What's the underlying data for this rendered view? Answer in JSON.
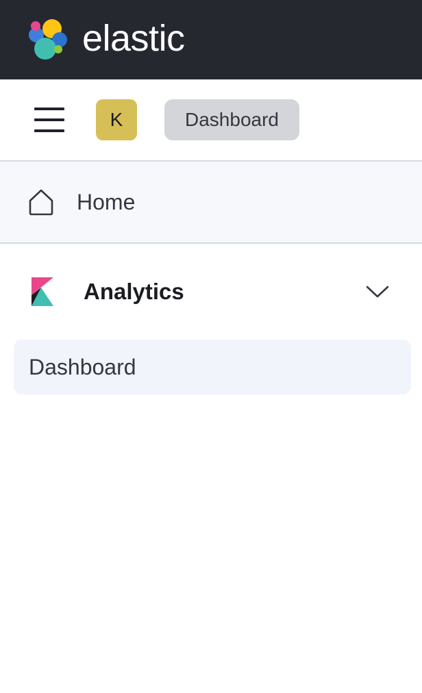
{
  "brand": {
    "name": "elastic",
    "logo_icon": "elastic-logo-icon"
  },
  "header": {
    "menu_icon": "hamburger-menu-icon",
    "space_avatar_letter": "K",
    "breadcrumb": "Dashboard"
  },
  "nav": {
    "home": {
      "label": "Home",
      "icon": "home-icon"
    },
    "sections": [
      {
        "title": "Analytics",
        "icon": "kibana-icon",
        "expanded": true,
        "items": [
          {
            "label": "Dashboard",
            "selected": true
          }
        ]
      }
    ]
  },
  "colors": {
    "topbar_bg": "#25282f",
    "avatar_bg": "#d6bf57",
    "breadcrumb_bg": "#d3d5d9",
    "home_row_bg": "#f7f8fc",
    "selected_item_bg": "#f1f4fa",
    "kibana_pink": "#e8478b",
    "kibana_teal": "#40bfb0"
  }
}
